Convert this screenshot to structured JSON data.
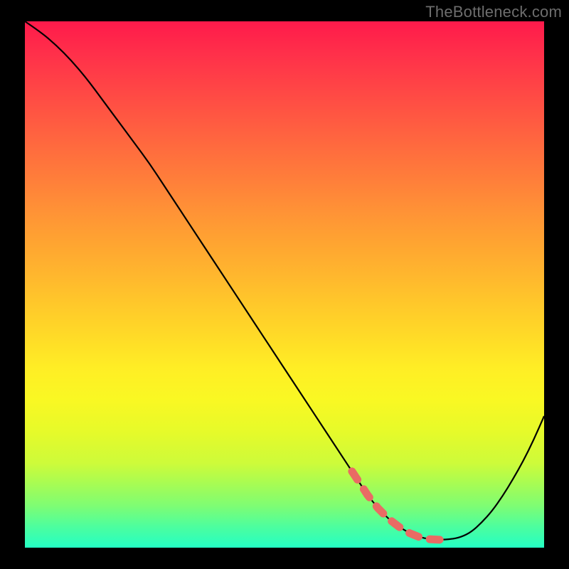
{
  "watermark": "TheBottleneck.com",
  "colors": {
    "background": "#000000",
    "curve": "#000000",
    "highlight": "#e96b64",
    "gradient_top": "#ff1a4b",
    "gradient_bottom": "#24ffc4"
  },
  "chart_data": {
    "type": "line",
    "title": "",
    "xlabel": "",
    "ylabel": "",
    "xlim": [
      0,
      100
    ],
    "ylim": [
      0,
      100
    ],
    "x": [
      0,
      3,
      6,
      9,
      12,
      15,
      18,
      21,
      24,
      27,
      30,
      33,
      36,
      39,
      42,
      45,
      48,
      51,
      54,
      57,
      60,
      63,
      66,
      68,
      70,
      72,
      74,
      76,
      78,
      80,
      82,
      84,
      86,
      88,
      90,
      92,
      94,
      96,
      98,
      100
    ],
    "values": [
      100,
      98,
      95.5,
      92.5,
      89,
      85,
      81,
      77,
      73,
      68.5,
      64,
      59.5,
      55,
      50.5,
      46,
      41.5,
      37,
      32.5,
      28,
      23.5,
      19,
      14.5,
      10,
      7.5,
      5.5,
      4,
      2.8,
      2,
      1.6,
      1.5,
      1.6,
      2,
      3,
      4.8,
      7,
      9.8,
      13,
      16.5,
      20.5,
      25
    ],
    "highlight_range_x": [
      63,
      82
    ],
    "grid": false,
    "legend": false
  }
}
